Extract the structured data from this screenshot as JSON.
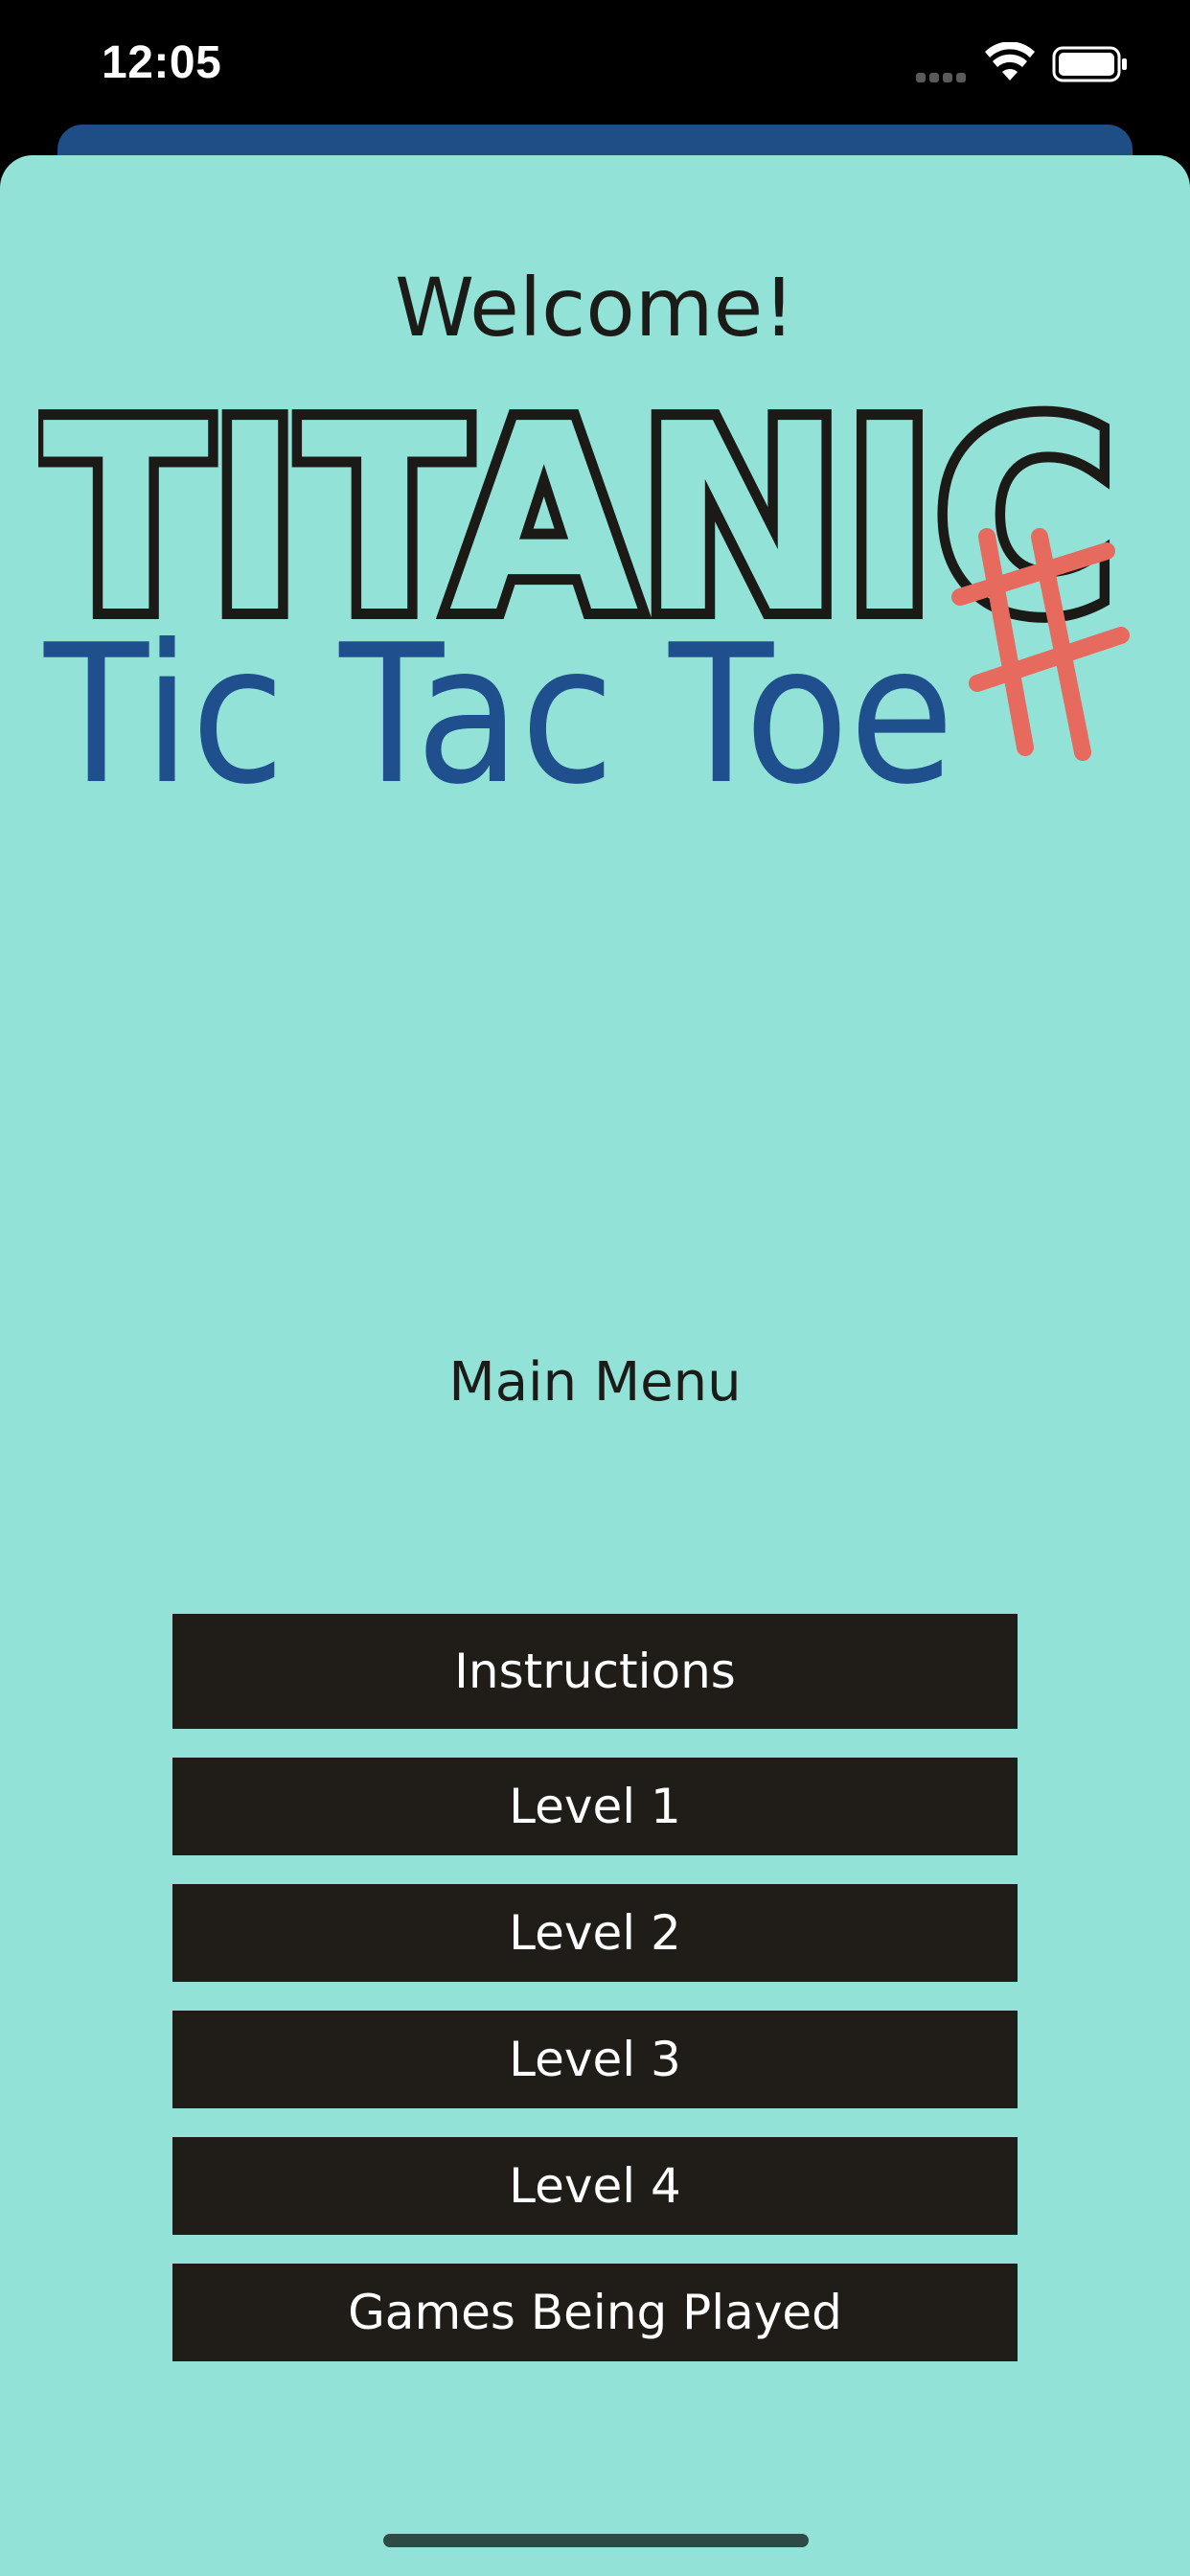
{
  "status_bar": {
    "time": "12:05",
    "icons": [
      "signal-icon",
      "wifi-icon",
      "battery-icon"
    ]
  },
  "header": {
    "welcome": "Welcome!"
  },
  "logo": {
    "title": "TITANIC",
    "subtitle": "Tic Tac Toe",
    "colors": {
      "title": "#1b1a17",
      "subtitle": "#1f4f8c",
      "hash": "#e76a5f"
    }
  },
  "menu": {
    "title": "Main Menu",
    "buttons": [
      {
        "label": "Instructions"
      },
      {
        "label": "Level 1"
      },
      {
        "label": "Level 2"
      },
      {
        "label": "Level 3"
      },
      {
        "label": "Level 4"
      },
      {
        "label": "Games Being Played"
      }
    ]
  },
  "colors": {
    "background": "#93e2d8",
    "button": "#201c17",
    "button_text": "#ffffff",
    "back_sheet": "#1f4e87"
  }
}
